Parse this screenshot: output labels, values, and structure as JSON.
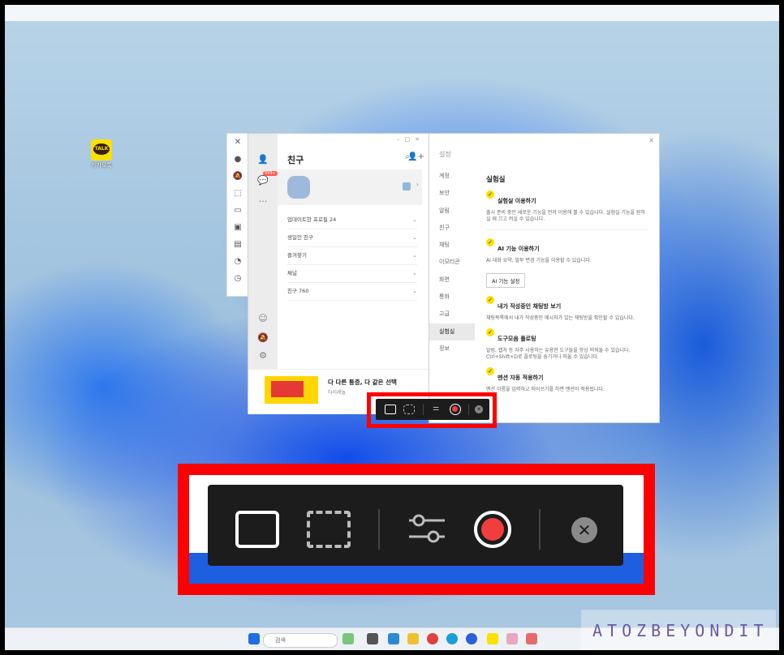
{
  "desktop_icon": {
    "label": "카카오톡",
    "badge": "TALK"
  },
  "kakao": {
    "title": "친구",
    "badge": "999+",
    "rows": [
      {
        "label": "업데이트한 프로필",
        "count": "24"
      },
      {
        "label": "생일인 친구",
        "count": ""
      },
      {
        "label": "즐겨찾기",
        "count": ""
      },
      {
        "label": "채널",
        "count": ""
      },
      {
        "label": "친구",
        "count": "760"
      }
    ],
    "ad": {
      "title": "다 다른 통증, 다 같은 선택",
      "sub": "타이레놀"
    }
  },
  "settings": {
    "header": "설정",
    "categories": [
      "계정",
      "보안",
      "알림",
      "친구",
      "채팅",
      "이모티콘",
      "화면",
      "통화",
      "고급",
      "실험실",
      "정보"
    ],
    "selected": "실험실",
    "section_title": "실험실",
    "options": [
      {
        "title": "실험실 이용하기",
        "desc": "출시 준비 중인 새로운 기능을 먼저 이용해 볼 수 있습니다. 실험실 기능을 원하실 때 끄고 켜실 수 있습니다."
      },
      {
        "title": "AI 기능 이용하기",
        "desc": "AI 대화 요약, 말투 변경 기능을 이용할 수 있습니다.",
        "button": "AI 기능 설정"
      },
      {
        "title": "내가 작성중인 채팅방 보기",
        "desc": "채팅목록에서 내가 작성중인 메시지가 있는 채팅방을 확인할 수 있습니다."
      },
      {
        "title": "도구모음 플로팅",
        "desc": "알림, 캡처 등 자주 사용하는 유용한 도구들을 항상 띄워둘 수 있습니다. Ctrl+Shift+D로 플로팅을 숨기거나 띄울 수 있습니다."
      },
      {
        "title": "멘션 자동 적용하기",
        "desc": "멘션 이름을 입력하고 띄어쓰기를 하면 멘션이 적용됩니다."
      }
    ]
  },
  "taskbar": {
    "search_placeholder": "검색"
  },
  "watermark": "ATOZBEYONDIT",
  "colors": {
    "highlight": "#ff0000",
    "kakao_yellow": "#fae100",
    "record_red": "#f03e3e",
    "toolbar_bg": "#1c1c1c"
  }
}
